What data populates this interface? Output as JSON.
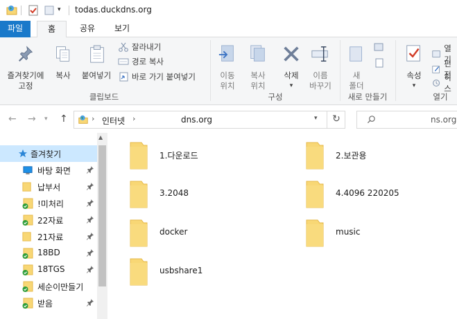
{
  "window": {
    "title": "todas.duckdns.org"
  },
  "tabs": [
    {
      "label": "파일"
    },
    {
      "label": "홈"
    },
    {
      "label": "공유"
    },
    {
      "label": "보기"
    }
  ],
  "ribbon": {
    "pin_quick": {
      "line1": "즐겨찾기에",
      "line2": "고정"
    },
    "copy": "복사",
    "paste": "붙여넣기",
    "cut": "잘라내기",
    "copy_path": "경로 복사",
    "paste_shortcut": "바로 가기 붙여넣기",
    "clipboard_group": "클립보드",
    "move_to": {
      "line1": "이동",
      "line2": "위치"
    },
    "copy_to": {
      "line1": "복사",
      "line2": "위치"
    },
    "delete": "삭제",
    "rename": {
      "line1": "이름",
      "line2": "바꾸기"
    },
    "organize_group": "구성",
    "new_folder": {
      "line1": "새",
      "line2": "폴더"
    },
    "new_group": "새로 만들기",
    "properties": "속성",
    "open_label": "열기",
    "open_partial": "열기",
    "edit_partial": "편전",
    "history_partial": "히스",
    "open_group": "열기"
  },
  "address": {
    "segment1": "인터넷",
    "segment2": "",
    "segment_end": "dns.org",
    "search_partial": "ns.org"
  },
  "nav": {
    "items": [
      {
        "label": "즐겨찾기",
        "selected": true
      },
      {
        "label": "바탕 화면",
        "icon": "desktop-icon"
      },
      {
        "label": "납부서",
        "icon": "folder-icon"
      },
      {
        "label": "!미처리",
        "icon": "folder-sync-icon"
      },
      {
        "label": "22자료",
        "icon": "folder-sync-icon"
      },
      {
        "label": "21자료",
        "icon": "folder-icon"
      },
      {
        "label": "18BD",
        "icon": "folder-sync-icon"
      },
      {
        "label": "18TGS",
        "icon": "folder-sync-icon"
      },
      {
        "label": "세순이만들기",
        "icon": "folder-sync-icon"
      },
      {
        "label": "받음",
        "icon": "folder-sync-icon"
      }
    ]
  },
  "files": [
    {
      "name": "1.다운로드"
    },
    {
      "name": "2.보관용"
    },
    {
      "name": "3.2048"
    },
    {
      "name": "4.4096 220205"
    },
    {
      "name": "docker"
    },
    {
      "name": "music"
    },
    {
      "name": "usbshare1"
    }
  ],
  "colors": {
    "accent": "#1979ca",
    "selected": "#cce8ff",
    "folder": "#f8d775",
    "folder_dark": "#e6b84a",
    "sync_green": "#2e9e3a"
  }
}
